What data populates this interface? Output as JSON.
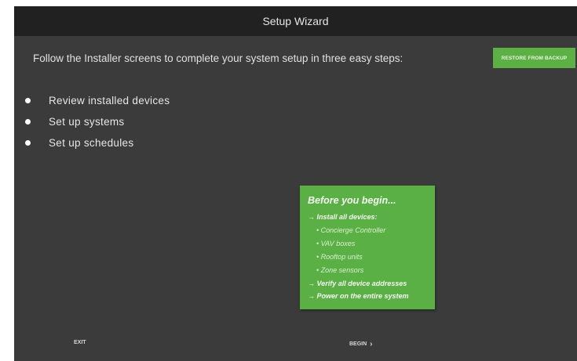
{
  "window": {
    "title": "Setup Wizard"
  },
  "intro": {
    "text": "Follow the Installer screens to complete your system setup in three easy steps:"
  },
  "restore_button": {
    "label": "RESTORE FROM BACKUP",
    "color": "#5db043"
  },
  "steps": [
    {
      "label": "Review installed devices"
    },
    {
      "label": "Set up systems"
    },
    {
      "label": "Set up schedules"
    }
  ],
  "note": {
    "title": "Before you begin...",
    "background": "#5ab045",
    "lines": [
      {
        "prefix": "→",
        "text": "Install all devices:"
      },
      {
        "prefix": "•",
        "text": "Concierge Controller"
      },
      {
        "prefix": "•",
        "text": "VAV boxes"
      },
      {
        "prefix": "•",
        "text": "Rooftop units"
      },
      {
        "prefix": "•",
        "text": "Zone sensors"
      },
      {
        "prefix": "→",
        "text": "Verify all device addresses"
      },
      {
        "prefix": "→",
        "text": "Power on the entire system"
      }
    ]
  },
  "footer": {
    "exit_label": "EXIT",
    "begin_label": "BEGIN",
    "begin_icon": "chevron-right-icon"
  }
}
